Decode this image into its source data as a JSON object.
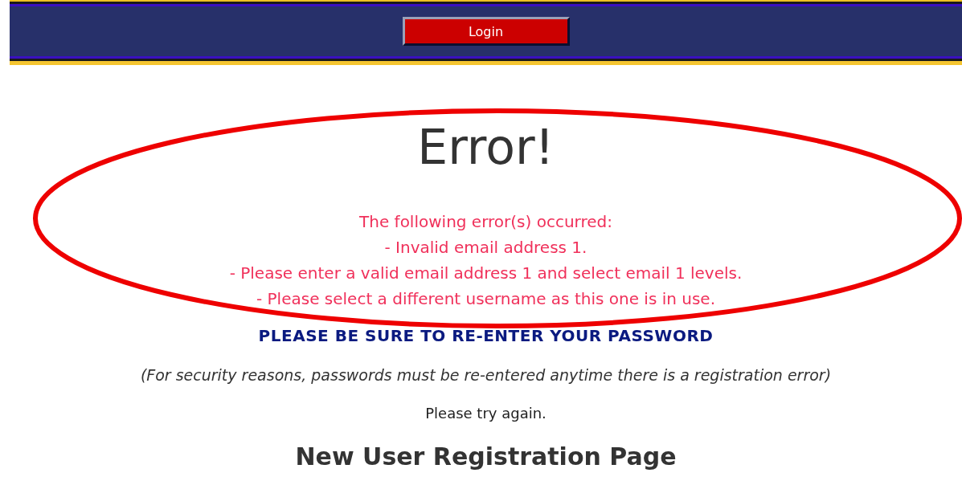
{
  "header": {
    "login_button": "Login"
  },
  "error": {
    "title": "Error!",
    "messages": [
      "The following error(s) occurred:",
      "- Invalid email address 1.",
      "- Please enter a valid email address 1 and select email 1 levels.",
      "- Please select a different username as this one is in use."
    ]
  },
  "password_notice": "PLEASE BE SURE TO RE-ENTER YOUR PASSWORD",
  "security_note": "(For security reasons, passwords must be re-entered anytime there is a registration error)",
  "retry_text": "Please try again.",
  "page_heading": "New User Registration Page"
}
